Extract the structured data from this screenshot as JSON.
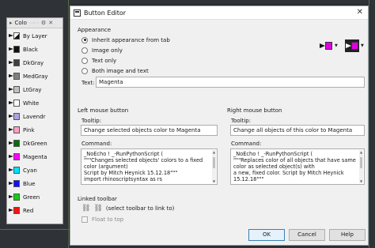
{
  "colors": {
    "black": "#111111",
    "dkgray": "#404040",
    "medgray": "#808080",
    "ltgray": "#c0c0c0",
    "white": "#ffffff",
    "lavender": "#b0a0e0",
    "pink": "#ff9ec8",
    "dkgreen": "#0b6b0b",
    "magenta": "#ff00ff",
    "cyan": "#00e0ff",
    "blue": "#1010ff",
    "green": "#10d010",
    "red": "#ff1010",
    "accent": "#3c7fb1"
  },
  "panel": {
    "title": "Colo",
    "items": [
      {
        "label": "By Layer",
        "icon": "by-layer-icon"
      },
      {
        "label": "Black",
        "icon": "black-swatch-icon"
      },
      {
        "label": "DkGray",
        "icon": "dkgray-swatch-icon"
      },
      {
        "label": "MedGray",
        "icon": "medgray-swatch-icon"
      },
      {
        "label": "LtGray",
        "icon": "ltgray-swatch-icon"
      },
      {
        "label": "White",
        "icon": "white-swatch-icon"
      },
      {
        "label": "Lavendr",
        "icon": "lavender-swatch-icon"
      },
      {
        "label": "Pink",
        "icon": "pink-swatch-icon"
      },
      {
        "label": "DkGreen",
        "icon": "dkgreen-swatch-icon"
      },
      {
        "label": "Magenta",
        "icon": "magenta-swatch-icon"
      },
      {
        "label": "Cyan",
        "icon": "cyan-swatch-icon"
      },
      {
        "label": "Blue",
        "icon": "blue-swatch-icon"
      },
      {
        "label": "Green",
        "icon": "green-swatch-icon"
      },
      {
        "label": "Red",
        "icon": "red-swatch-icon"
      }
    ]
  },
  "dialog": {
    "title": "Button Editor",
    "appearance_label": "Appearance",
    "radio_options": [
      "Inherit appearance from tab",
      "Image only",
      "Text only",
      "Both image and text"
    ],
    "selected_radio": 0,
    "text_label": "Text:",
    "text_value": "Magenta",
    "left": {
      "section_label": "Left mouse button",
      "tooltip_label": "Tooltip:",
      "tooltip_value": "Change selected objects color to Magenta",
      "command_label": "Command:",
      "command_lines": [
        "_NoEcho ! _-RunPythonScript (",
        "\"\"\"Changes selected objects' colors to a fixed",
        "color (argument)",
        "Script by Mitch Heynick 15.12.18\"\"\"",
        "import rhinoscriptsyntax as rs"
      ]
    },
    "right": {
      "section_label": "Right mouse button",
      "tooltip_label": "Tooltip:",
      "tooltip_value": "Change all objects of this color to Magenta",
      "command_label": "Command:",
      "command_lines": [
        "_NoEcho ! _-RunPythonScript (",
        "\"\"\"Replaces color of all objects that have same",
        "color as selected object(s) with",
        "a new, fixed color.  Script by Mitch Heynick",
        "15.12.18\"\"\""
      ]
    },
    "linked_toolbar_label": "Linked toolbar",
    "linked_toolbar_hint": "(select toolbar to link to)",
    "float_label": "Float to top",
    "ok_label": "OK",
    "cancel_label": "Cancel",
    "help_label": "Help"
  }
}
